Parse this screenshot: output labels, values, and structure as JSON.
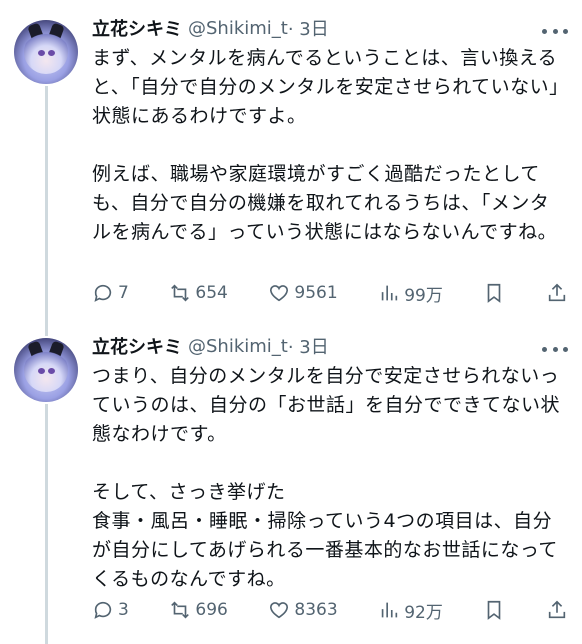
{
  "tweets": [
    {
      "author_name": "立花シキミ",
      "handle": "@Shikimi_t",
      "time": "· 3日",
      "text": "まず、メンタルを病んでるということは、言い換えると、「自分で自分のメンタルを安定させられていない」状態にあるわけですよ。\n\n例えば、職場や家庭環境がすごく過酷だったとしても、自分で自分の機嫌を取れてれるうちは、「メンタルを病んでる」っていう状態にはならないんですね。",
      "replies": "7",
      "retweets": "654",
      "likes": "9561",
      "views": "99万"
    },
    {
      "author_name": "立花シキミ",
      "handle": "@Shikimi_t",
      "time": "· 3日",
      "text": "つまり、自分のメンタルを自分で安定させられないっていうのは、自分の「お世話」を自分でできてない状態なわけです。\n\nそして、さっき挙げた\n食事・風呂・睡眠・掃除っていう4つの項目は、自分が自分にしてあげられる一番基本的なお世話になってくるものなんですね。",
      "replies": "3",
      "retweets": "696",
      "likes": "8363",
      "views": "92万"
    }
  ],
  "icons": {
    "reply": "reply-icon",
    "retweet": "retweet-icon",
    "like": "heart-icon",
    "views": "views-icon",
    "bookmark": "bookmark-icon",
    "share": "share-icon",
    "more": "more-icon"
  }
}
